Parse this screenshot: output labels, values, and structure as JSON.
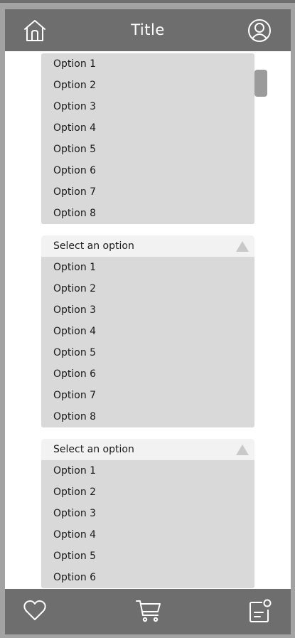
{
  "header": {
    "title": "Title",
    "home_icon": "home-icon",
    "profile_icon": "user-profile-icon",
    "background": "#6e6e6e"
  },
  "dropdowns": [
    {
      "options": [
        "Option 1",
        "Option 2",
        "Option 3",
        "Option 4",
        "Option 5",
        "Option 6",
        "Option 7",
        "Option 8"
      ]
    },
    {
      "placeholder": "Select an option",
      "options": [
        "Option 1",
        "Option 2",
        "Option 3",
        "Option 4",
        "Option 5",
        "Option 6",
        "Option 7",
        "Option 8"
      ]
    },
    {
      "placeholder": "Select an option",
      "options": [
        "Option 1",
        "Option 2",
        "Option 3",
        "Option 4",
        "Option 5",
        "Option 6"
      ]
    }
  ],
  "footer": {
    "icons": [
      "heart-icon",
      "cart-icon",
      "notes-icon"
    ]
  },
  "colors": {
    "bar": "#6e6e6e",
    "option_bg": "#d9d9d9",
    "select_bg": "#f2f2f2",
    "outer_bg": "#a3a3a3"
  }
}
